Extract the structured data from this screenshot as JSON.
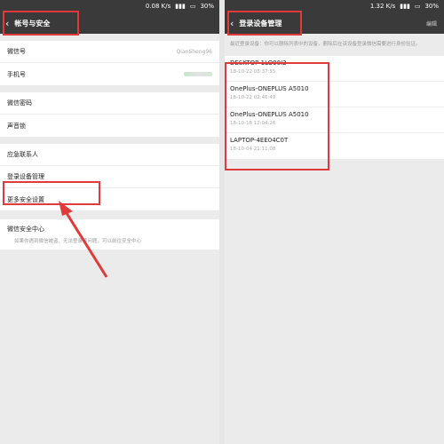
{
  "left": {
    "status": {
      "speed": "0.08 K/s",
      "battery": "30%"
    },
    "title": "帐号与安全",
    "group1": [
      {
        "label": "微信号",
        "value": "QianSheng96"
      },
      {
        "label": "手机号",
        "value": ""
      }
    ],
    "group2": [
      {
        "label": "微信密码"
      },
      {
        "label": "声音锁"
      }
    ],
    "group3": [
      {
        "label": "应急联系人"
      },
      {
        "label": "登录设备管理"
      },
      {
        "label": "更多安全设置"
      }
    ],
    "security": {
      "title": "微信安全中心",
      "desc": "如果你遇到微信被盗、无法登录等问题，可以前往安全中心"
    }
  },
  "right": {
    "status": {
      "speed": "1.32 K/s",
      "battery": "30%"
    },
    "title": "登录设备管理",
    "action": "编辑",
    "hint": "最近登录设备：你可以删除列表中的设备，删除后在该设备登录微信需要进行身份验证。",
    "devices": [
      {
        "name": "DESKTOP-1LO98I2",
        "time": "18-10-22 08:37:55"
      },
      {
        "name": "OnePlus-ONEPLUS A5010",
        "time": "18-10-22 02:46:49"
      },
      {
        "name": "OnePlus-ONEPLUS A5010",
        "time": "18-10-18 12:04:26"
      },
      {
        "name": "LAPTOP-4EE04C0T",
        "time": "18-10-04 21:11:08"
      }
    ]
  },
  "colors": {
    "highlight": "#e03a3a",
    "titlebar": "#3a3a3a"
  },
  "icons": [
    "back-arrow-icon",
    "signal-icon",
    "wifi-icon",
    "battery-icon",
    "arrow-annotation"
  ]
}
